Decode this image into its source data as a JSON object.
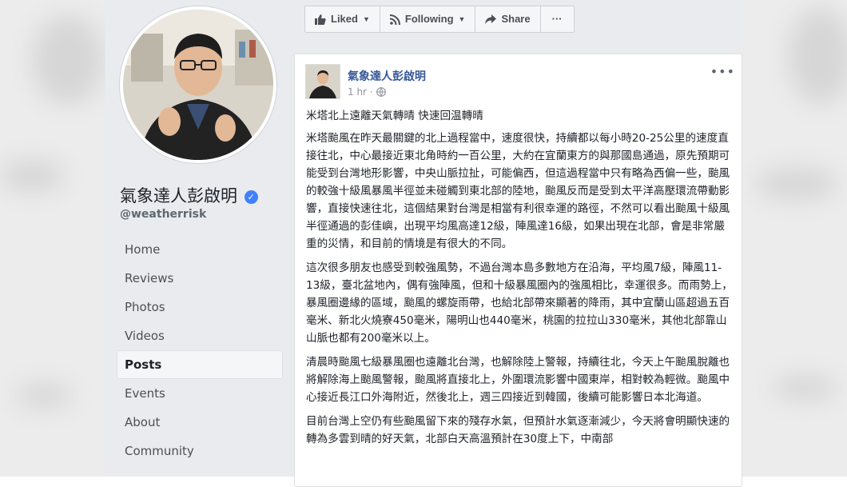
{
  "page": {
    "name": "氣象達人彭啟明",
    "handle": "@weatherrisk"
  },
  "nav": {
    "items": [
      {
        "label": "Home"
      },
      {
        "label": "Reviews"
      },
      {
        "label": "Photos"
      },
      {
        "label": "Videos"
      },
      {
        "label": "Posts"
      },
      {
        "label": "Events"
      },
      {
        "label": "About"
      },
      {
        "label": "Community"
      }
    ],
    "active": "Posts"
  },
  "actions": {
    "liked": "Liked",
    "following": "Following",
    "share": "Share",
    "more": "···"
  },
  "post": {
    "author": "氣象達人彭啟明",
    "time": "1 hr",
    "title": "米塔北上遠離天氣轉晴 快速回温轉晴",
    "paragraphs": [
      "米塔颱風在昨天最關鍵的北上過程當中，速度很快，持續都以每小時20-25公里的速度直接往北，中心最接近東北角時約一百公里，大約在宜蘭東方的與那國島通過，原先預期可能受到台灣地形影響，中央山脈拉扯，可能偏西，但這過程當中只有略為西偏一些，颱風的較強十級風暴風半徑並未碰觸到東北部的陸地，颱風反而是受到太平洋高壓環流帶動影響，直接快速往北，這個結果對台灣是相當有利很幸運的路徑，不然可以看出颱風十級風半徑通過的彭佳嶼，出現平均風高達12級，陣風達16級，如果出現在北部，會是非常嚴重的災情，和目前的情境是有很大的不同。",
      "這次很多朋友也感受到較強風勢，不過台灣本島多數地方在沿海，平均風7級，陣風11-13級，臺北盆地內，偶有強陣風，但和十級暴風圈內的強風相比，幸運很多。而雨勢上，暴風圈邊緣的區域，颱風的螺旋雨帶，也給北部帶來顯著的降雨，其中宜蘭山區超過五百毫米、新北火燒寮450毫米，陽明山也440毫米，桃園的拉拉山330毫米，其他北部靠山山脈也都有200毫米以上。",
      "清晨時颱風七級暴風圈也遠離北台灣，也解除陸上警報，持續往北，今天上午颱風脫離也將解除海上颱風警報，颱風將直接北上，外圍環流影響中國東岸，相對較為輕微。颱風中心接近長江口外海附近，然後北上，週三四接近到韓國，後續可能影響日本北海道。",
      "目前台灣上空仍有些颱風留下來的殘存水氣，但預計水氣逐漸減少，今天將會明顯快速的轉為多雲到晴的好天氣，北部白天高溫預計在30度上下，中南部"
    ]
  },
  "colors": {
    "link": "#385898",
    "background": "#e9ebee",
    "verified": "#4080ff"
  }
}
